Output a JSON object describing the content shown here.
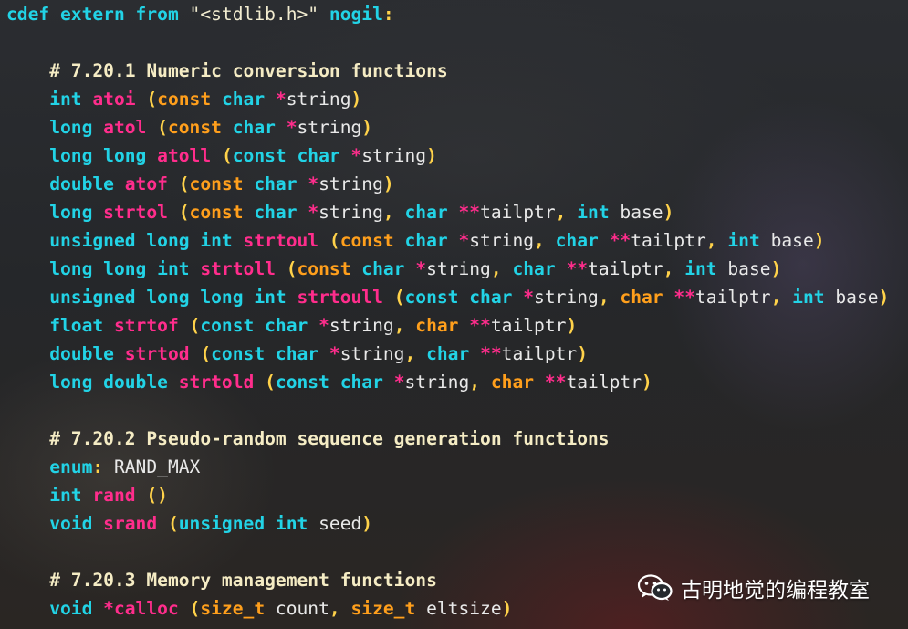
{
  "code_lines": [
    [
      {
        "t": "kw",
        "v": "cdef extern from "
      },
      {
        "t": "str",
        "v": "\"<stdlib.h>\""
      },
      {
        "t": "kw",
        "v": " nogil"
      },
      {
        "t": "pn",
        "v": ":"
      }
    ],
    [],
    [
      {
        "t": "id",
        "v": "    "
      },
      {
        "t": "cm",
        "v": "# 7.20.1 Numeric conversion functions"
      }
    ],
    [
      {
        "t": "id",
        "v": "    "
      },
      {
        "t": "kw",
        "v": "int "
      },
      {
        "t": "fn",
        "v": "atoi"
      },
      {
        "t": "id",
        "v": " "
      },
      {
        "t": "pn",
        "v": "("
      },
      {
        "t": "mod",
        "v": "const "
      },
      {
        "t": "kw",
        "v": "char "
      },
      {
        "t": "op",
        "v": "*"
      },
      {
        "t": "id",
        "v": "string"
      },
      {
        "t": "pn",
        "v": ")"
      }
    ],
    [
      {
        "t": "id",
        "v": "    "
      },
      {
        "t": "kw",
        "v": "long "
      },
      {
        "t": "fn",
        "v": "atol"
      },
      {
        "t": "id",
        "v": " "
      },
      {
        "t": "pn",
        "v": "("
      },
      {
        "t": "mod",
        "v": "const "
      },
      {
        "t": "kw",
        "v": "char "
      },
      {
        "t": "op",
        "v": "*"
      },
      {
        "t": "id",
        "v": "string"
      },
      {
        "t": "pn",
        "v": ")"
      }
    ],
    [
      {
        "t": "id",
        "v": "    "
      },
      {
        "t": "kw",
        "v": "long long "
      },
      {
        "t": "fn",
        "v": "atoll"
      },
      {
        "t": "id",
        "v": " "
      },
      {
        "t": "pn",
        "v": "("
      },
      {
        "t": "kw",
        "v": "const char "
      },
      {
        "t": "op",
        "v": "*"
      },
      {
        "t": "id",
        "v": "string"
      },
      {
        "t": "pn",
        "v": ")"
      }
    ],
    [
      {
        "t": "id",
        "v": "    "
      },
      {
        "t": "kw",
        "v": "double "
      },
      {
        "t": "fn",
        "v": "atof"
      },
      {
        "t": "id",
        "v": " "
      },
      {
        "t": "pn",
        "v": "("
      },
      {
        "t": "mod",
        "v": "const "
      },
      {
        "t": "kw",
        "v": "char "
      },
      {
        "t": "op",
        "v": "*"
      },
      {
        "t": "id",
        "v": "string"
      },
      {
        "t": "pn",
        "v": ")"
      }
    ],
    [
      {
        "t": "id",
        "v": "    "
      },
      {
        "t": "kw",
        "v": "long "
      },
      {
        "t": "fn",
        "v": "strtol"
      },
      {
        "t": "id",
        "v": " "
      },
      {
        "t": "pn",
        "v": "("
      },
      {
        "t": "mod",
        "v": "const "
      },
      {
        "t": "kw",
        "v": "char "
      },
      {
        "t": "op",
        "v": "*"
      },
      {
        "t": "id",
        "v": "string"
      },
      {
        "t": "pn",
        "v": ", "
      },
      {
        "t": "kw",
        "v": "char "
      },
      {
        "t": "op",
        "v": "**"
      },
      {
        "t": "id",
        "v": "tailptr"
      },
      {
        "t": "pn",
        "v": ", "
      },
      {
        "t": "kw",
        "v": "int "
      },
      {
        "t": "id",
        "v": "base"
      },
      {
        "t": "pn",
        "v": ")"
      }
    ],
    [
      {
        "t": "id",
        "v": "    "
      },
      {
        "t": "kw",
        "v": "unsigned long int "
      },
      {
        "t": "fn",
        "v": "strtoul"
      },
      {
        "t": "id",
        "v": " "
      },
      {
        "t": "pn",
        "v": "("
      },
      {
        "t": "mod",
        "v": "const "
      },
      {
        "t": "kw",
        "v": "char "
      },
      {
        "t": "op",
        "v": "*"
      },
      {
        "t": "id",
        "v": "string"
      },
      {
        "t": "pn",
        "v": ", "
      },
      {
        "t": "kw",
        "v": "char "
      },
      {
        "t": "op",
        "v": "**"
      },
      {
        "t": "id",
        "v": "tailptr"
      },
      {
        "t": "pn",
        "v": ", "
      },
      {
        "t": "kw",
        "v": "int "
      },
      {
        "t": "id",
        "v": "base"
      },
      {
        "t": "pn",
        "v": ")"
      }
    ],
    [
      {
        "t": "id",
        "v": "    "
      },
      {
        "t": "kw",
        "v": "long long int "
      },
      {
        "t": "fn",
        "v": "strtoll"
      },
      {
        "t": "id",
        "v": " "
      },
      {
        "t": "pn",
        "v": "("
      },
      {
        "t": "mod",
        "v": "const "
      },
      {
        "t": "kw",
        "v": "char "
      },
      {
        "t": "op",
        "v": "*"
      },
      {
        "t": "id",
        "v": "string"
      },
      {
        "t": "pn",
        "v": ", "
      },
      {
        "t": "kw",
        "v": "char "
      },
      {
        "t": "op",
        "v": "**"
      },
      {
        "t": "id",
        "v": "tailptr"
      },
      {
        "t": "pn",
        "v": ", "
      },
      {
        "t": "kw",
        "v": "int "
      },
      {
        "t": "id",
        "v": "base"
      },
      {
        "t": "pn",
        "v": ")"
      }
    ],
    [
      {
        "t": "id",
        "v": "    "
      },
      {
        "t": "kw",
        "v": "unsigned long long int "
      },
      {
        "t": "fn",
        "v": "strtoull"
      },
      {
        "t": "id",
        "v": " "
      },
      {
        "t": "pn",
        "v": "("
      },
      {
        "t": "kw",
        "v": "const char "
      },
      {
        "t": "op",
        "v": "*"
      },
      {
        "t": "id",
        "v": "string"
      },
      {
        "t": "pn",
        "v": ", "
      },
      {
        "t": "mod",
        "v": "char "
      },
      {
        "t": "op",
        "v": "**"
      },
      {
        "t": "id",
        "v": "tailptr"
      },
      {
        "t": "pn",
        "v": ", "
      },
      {
        "t": "kw",
        "v": "int "
      },
      {
        "t": "id",
        "v": "base"
      },
      {
        "t": "pn",
        "v": ")"
      }
    ],
    [
      {
        "t": "id",
        "v": "    "
      },
      {
        "t": "kw",
        "v": "float "
      },
      {
        "t": "fn",
        "v": "strtof"
      },
      {
        "t": "id",
        "v": " "
      },
      {
        "t": "pn",
        "v": "("
      },
      {
        "t": "kw",
        "v": "const char "
      },
      {
        "t": "op",
        "v": "*"
      },
      {
        "t": "id",
        "v": "string"
      },
      {
        "t": "pn",
        "v": ", "
      },
      {
        "t": "mod",
        "v": "char "
      },
      {
        "t": "op",
        "v": "**"
      },
      {
        "t": "id",
        "v": "tailptr"
      },
      {
        "t": "pn",
        "v": ")"
      }
    ],
    [
      {
        "t": "id",
        "v": "    "
      },
      {
        "t": "kw",
        "v": "double "
      },
      {
        "t": "fn",
        "v": "strtod"
      },
      {
        "t": "id",
        "v": " "
      },
      {
        "t": "pn",
        "v": "("
      },
      {
        "t": "kw",
        "v": "const char "
      },
      {
        "t": "op",
        "v": "*"
      },
      {
        "t": "id",
        "v": "string"
      },
      {
        "t": "pn",
        "v": ", "
      },
      {
        "t": "kw",
        "v": "char "
      },
      {
        "t": "op",
        "v": "**"
      },
      {
        "t": "id",
        "v": "tailptr"
      },
      {
        "t": "pn",
        "v": ")"
      }
    ],
    [
      {
        "t": "id",
        "v": "    "
      },
      {
        "t": "kw",
        "v": "long double "
      },
      {
        "t": "fn",
        "v": "strtold"
      },
      {
        "t": "id",
        "v": " "
      },
      {
        "t": "pn",
        "v": "("
      },
      {
        "t": "kw",
        "v": "const char "
      },
      {
        "t": "op",
        "v": "*"
      },
      {
        "t": "id",
        "v": "string"
      },
      {
        "t": "pn",
        "v": ", "
      },
      {
        "t": "mod",
        "v": "char "
      },
      {
        "t": "op",
        "v": "**"
      },
      {
        "t": "id",
        "v": "tailptr"
      },
      {
        "t": "pn",
        "v": ")"
      }
    ],
    [],
    [
      {
        "t": "id",
        "v": "    "
      },
      {
        "t": "cm",
        "v": "# 7.20.2 Pseudo-random sequence generation functions"
      }
    ],
    [
      {
        "t": "id",
        "v": "    "
      },
      {
        "t": "kw",
        "v": "enum"
      },
      {
        "t": "pn",
        "v": ":"
      },
      {
        "t": "id",
        "v": " RAND_MAX"
      }
    ],
    [
      {
        "t": "id",
        "v": "    "
      },
      {
        "t": "kw",
        "v": "int "
      },
      {
        "t": "fn",
        "v": "rand"
      },
      {
        "t": "id",
        "v": " "
      },
      {
        "t": "pn",
        "v": "()"
      }
    ],
    [
      {
        "t": "id",
        "v": "    "
      },
      {
        "t": "kw",
        "v": "void "
      },
      {
        "t": "fn",
        "v": "srand"
      },
      {
        "t": "id",
        "v": " "
      },
      {
        "t": "pn",
        "v": "("
      },
      {
        "t": "kw",
        "v": "unsigned int "
      },
      {
        "t": "id",
        "v": "seed"
      },
      {
        "t": "pn",
        "v": ")"
      }
    ],
    [],
    [
      {
        "t": "id",
        "v": "    "
      },
      {
        "t": "cm",
        "v": "# 7.20.3 Memory management functions"
      }
    ],
    [
      {
        "t": "id",
        "v": "    "
      },
      {
        "t": "kw",
        "v": "void "
      },
      {
        "t": "op",
        "v": "*"
      },
      {
        "t": "fn",
        "v": "calloc"
      },
      {
        "t": "id",
        "v": " "
      },
      {
        "t": "pn",
        "v": "("
      },
      {
        "t": "mod",
        "v": "size_t "
      },
      {
        "t": "id",
        "v": "count"
      },
      {
        "t": "pn",
        "v": ", "
      },
      {
        "t": "mod",
        "v": "size_t "
      },
      {
        "t": "id",
        "v": "eltsize"
      },
      {
        "t": "pn",
        "v": ")"
      }
    ]
  ],
  "watermark": {
    "icon": "wechat-icon",
    "text": "古明地觉的编程教室"
  }
}
